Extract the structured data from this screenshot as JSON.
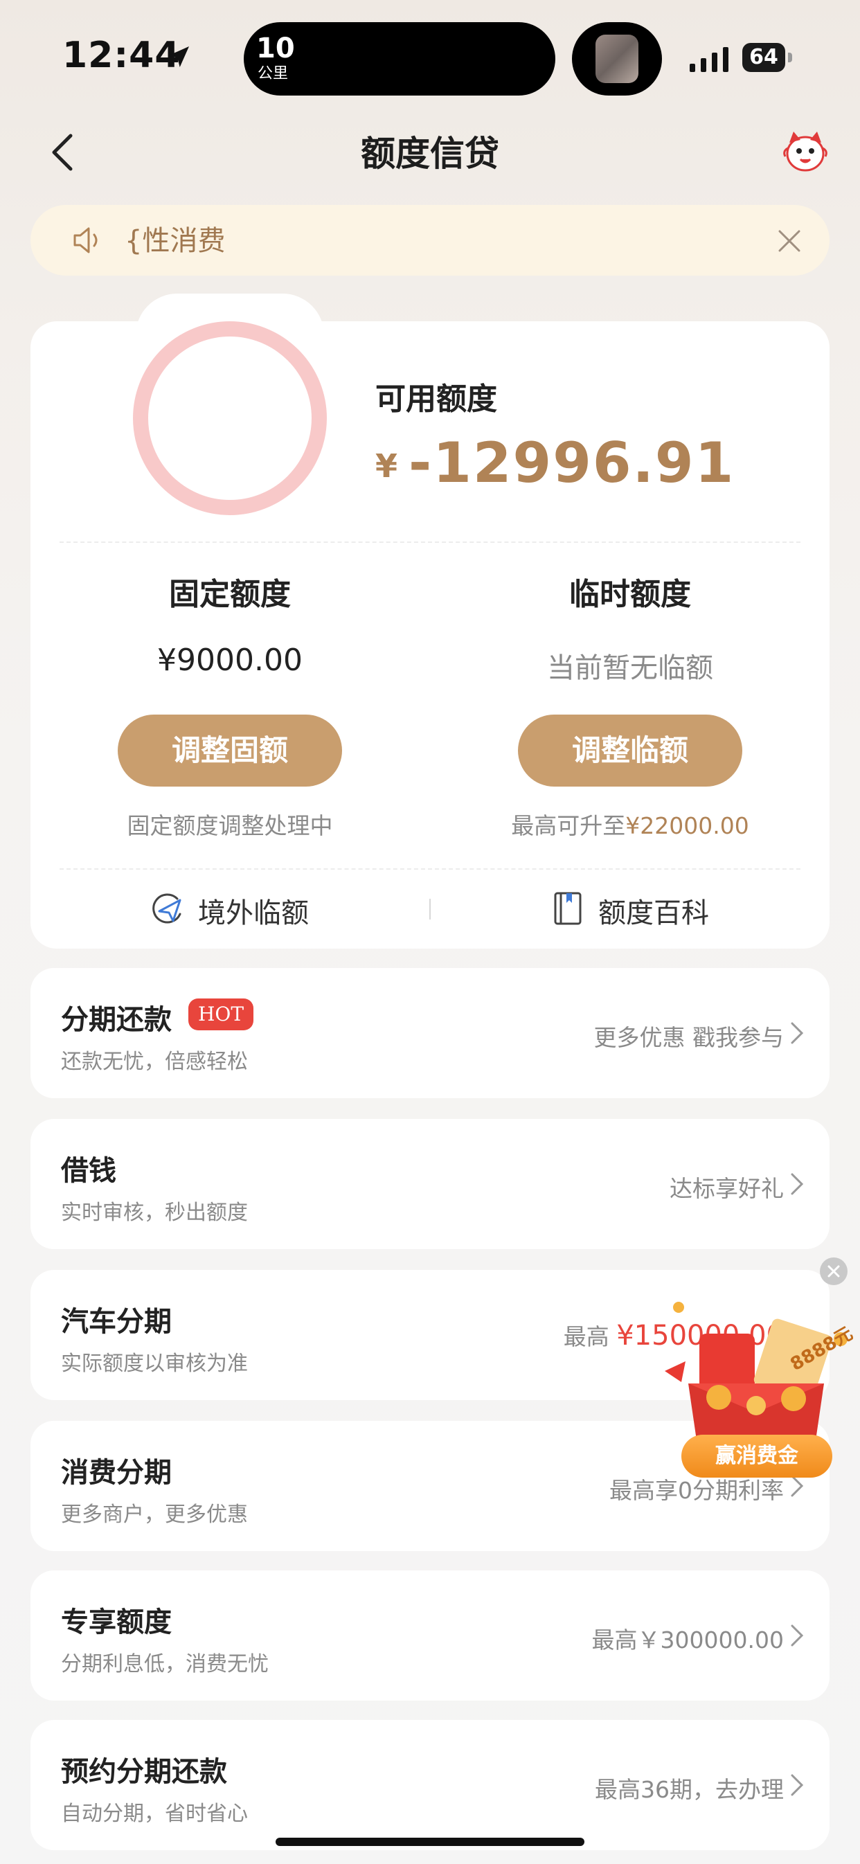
{
  "status_bar": {
    "time": "12:44",
    "island_value": "10",
    "island_unit": "公里",
    "battery": "64"
  },
  "header": {
    "title": "额度信贷"
  },
  "notice": {
    "text": "{性消费"
  },
  "credit": {
    "available_label": "可用额度",
    "currency_symbol": "¥",
    "available_amount": "-12996.91",
    "fixed": {
      "title": "固定额度",
      "value": "¥9000.00",
      "button": "调整固额",
      "note": "固定额度调整处理中"
    },
    "temporary": {
      "title": "临时额度",
      "value": "当前暂无临额",
      "button": "调整临额",
      "note_prefix": "最高可升至",
      "note_amount": "¥22000.00"
    },
    "links": {
      "overseas": "境外临额",
      "encyclopedia": "额度百科"
    }
  },
  "list": [
    {
      "title": "分期还款",
      "subtitle": "还款无忧，倍感轻松",
      "right": "更多优惠 戳我参与",
      "badge": "HOT"
    },
    {
      "title": "借钱",
      "subtitle": "实时审核，秒出额度",
      "right": "达标享好礼"
    },
    {
      "title": "汽车分期",
      "subtitle": "实际额度以审核为准",
      "right_prefix": "最高",
      "right_amount": "¥150000.00"
    },
    {
      "title": "消费分期",
      "subtitle": "更多商户，更多优惠",
      "right": "最高享0分期利率"
    },
    {
      "title": "专享额度",
      "subtitle": "分期利息低，消费无忧",
      "right": "最高￥300000.00"
    },
    {
      "title": "预约分期还款",
      "subtitle": "自动分期，省时省心",
      "right": "最高36期，去办理"
    }
  ],
  "promo": {
    "button": "赢消费金",
    "ticket_text": "8888元"
  },
  "colors": {
    "gold": "#b08356",
    "button_gold": "#c99e6e",
    "ring_pink": "#f8c9c9",
    "red": "#e8453c",
    "notice_bg": "#fcf4e4"
  }
}
